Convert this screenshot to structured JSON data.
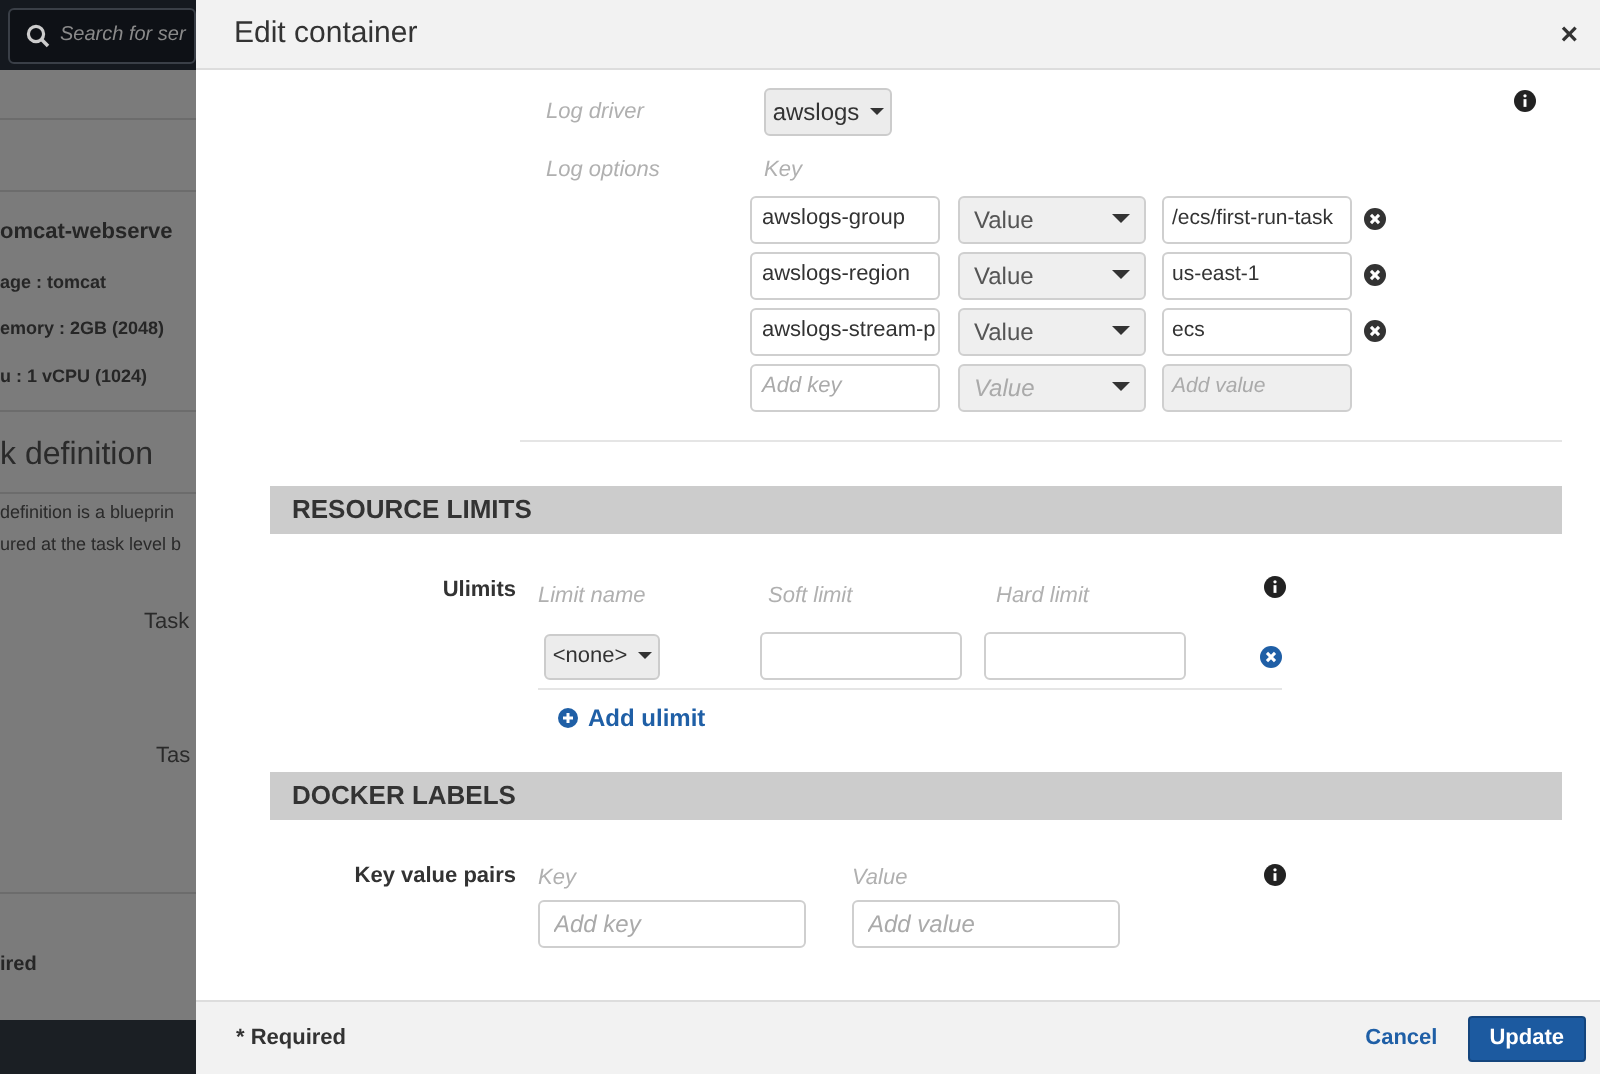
{
  "background_page": {
    "search": {
      "placeholder": "Search for ser"
    },
    "container_name": "omcat-webserve",
    "details": [
      "age : tomcat",
      "emory :  2GB (2048)",
      "u :  1 vCPU (1024)"
    ],
    "heading": "k definition",
    "description_lines": [
      "definition is a blueprin",
      "ured at the task level b"
    ],
    "field_labels": [
      "Task",
      "Tas"
    ],
    "footer_text": "ired"
  },
  "modal": {
    "title": "Edit container",
    "close": "×",
    "log_driver": {
      "label": "Log driver",
      "value": "awslogs"
    },
    "log_options": {
      "label": "Log options",
      "key_header": "Key",
      "rows": [
        {
          "key": "awslogs-group",
          "type": "Value",
          "value": "/ecs/first-run-task"
        },
        {
          "key": "awslogs-region",
          "type": "Value",
          "value": "us-east-1"
        },
        {
          "key": "awslogs-stream-p",
          "type": "Value",
          "value": "ecs"
        }
      ],
      "new_row": {
        "key_placeholder": "Add key",
        "type": "Value",
        "value_placeholder": "Add value"
      }
    },
    "resource_limits": {
      "title": "RESOURCE LIMITS",
      "label": "Ulimits",
      "columns": [
        "Limit name",
        "Soft limit",
        "Hard limit"
      ],
      "rows": [
        {
          "limit_name": "<none>"
        }
      ],
      "add_link": "Add ulimit"
    },
    "docker_labels": {
      "title": "DOCKER LABELS",
      "label": "Key value pairs",
      "columns": [
        "Key",
        "Value"
      ],
      "key_placeholder": "Add key",
      "value_placeholder": "Add value"
    },
    "footer": {
      "required_note": "* Required",
      "cancel": "Cancel",
      "update": "Update"
    }
  }
}
